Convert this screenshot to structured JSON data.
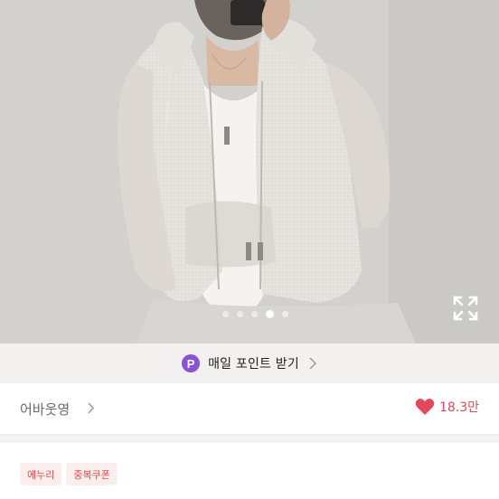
{
  "gallery": {
    "expand_icon": "expand-icon",
    "slide_count": 5,
    "active_slide": 3
  },
  "points_bar": {
    "icon": "P",
    "label": "매일 포인트 받기",
    "icon_color": "#8a53d6"
  },
  "seller": {
    "name": "어바웃영",
    "likes": "18.3만",
    "like_color": "#e5485d"
  },
  "badges": [
    {
      "label": "에누리"
    },
    {
      "label": "중복쿠폰"
    }
  ]
}
